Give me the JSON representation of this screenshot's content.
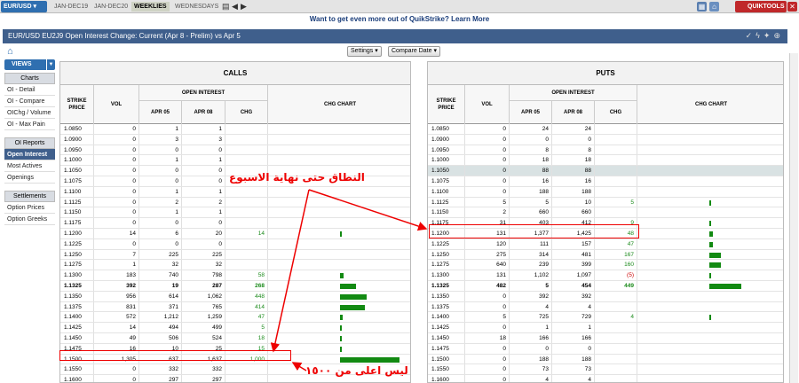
{
  "topbar": {
    "symbol": "EUR/USD",
    "tabs": [
      {
        "label": "JAN-DEC19",
        "active": false
      },
      {
        "label": "JAN-DEC20",
        "active": false
      },
      {
        "label": "WEEKLIES",
        "active": true
      },
      {
        "label": "WEDNESDAYS",
        "active": false
      }
    ],
    "tools_label": "QUIKTOOLS"
  },
  "promo": "Want to get even more out of QuikStrike? Learn More",
  "title": "EUR/USD EU2J9 Open Interest Change: Current (Apr 8 - Prelim) vs Apr 5",
  "controls": {
    "settings": "Settings",
    "compare": "Compare Date"
  },
  "sidebar": {
    "views": "VIEWS",
    "groups": [
      {
        "head": "Charts",
        "items": [
          "OI - Detail",
          "OI - Compare",
          "OIChg / Volume",
          "OI - Max Pain"
        ]
      },
      {
        "head": "OI Reports",
        "items": [
          "Open Interest",
          "Most Actives",
          "Openings"
        ]
      },
      {
        "head": "Settlements",
        "items": [
          "Option Prices",
          "Option Greeks"
        ]
      }
    ],
    "active": "Open Interest"
  },
  "headers": {
    "strike": "STRIKE PRICE",
    "vol": "VOL",
    "oi": "OPEN INTEREST",
    "apr05": "APR 05",
    "apr08": "APR 08",
    "chg": "CHG",
    "chart": "CHG CHART"
  },
  "calls": {
    "title": "CALLS",
    "rows": [
      {
        "strike": "1.0850",
        "vol": "0",
        "a5": "1",
        "a8": "1",
        "chg": ""
      },
      {
        "strike": "1.0900",
        "vol": "0",
        "a5": "3",
        "a8": "3",
        "chg": ""
      },
      {
        "strike": "1.0950",
        "vol": "0",
        "a5": "0",
        "a8": "0",
        "chg": ""
      },
      {
        "strike": "1.1000",
        "vol": "0",
        "a5": "1",
        "a8": "1",
        "chg": ""
      },
      {
        "strike": "1.1050",
        "vol": "0",
        "a5": "0",
        "a8": "0",
        "chg": ""
      },
      {
        "strike": "1.1075",
        "vol": "0",
        "a5": "0",
        "a8": "0",
        "chg": ""
      },
      {
        "strike": "1.1100",
        "vol": "0",
        "a5": "1",
        "a8": "1",
        "chg": ""
      },
      {
        "strike": "1.1125",
        "vol": "0",
        "a5": "2",
        "a8": "2",
        "chg": ""
      },
      {
        "strike": "1.1150",
        "vol": "0",
        "a5": "1",
        "a8": "1",
        "chg": ""
      },
      {
        "strike": "1.1175",
        "vol": "0",
        "a5": "0",
        "a8": "0",
        "chg": ""
      },
      {
        "strike": "1.1200",
        "vol": "14",
        "a5": "6",
        "a8": "20",
        "chg": "14"
      },
      {
        "strike": "1.1225",
        "vol": "0",
        "a5": "0",
        "a8": "0",
        "chg": ""
      },
      {
        "strike": "1.1250",
        "vol": "7",
        "a5": "225",
        "a8": "225",
        "chg": ""
      },
      {
        "strike": "1.1275",
        "vol": "1",
        "a5": "32",
        "a8": "32",
        "chg": ""
      },
      {
        "strike": "1.1300",
        "vol": "183",
        "a5": "740",
        "a8": "798",
        "chg": "58"
      },
      {
        "strike": "1.1325",
        "vol": "392",
        "a5": "19",
        "a8": "287",
        "chg": "268"
      },
      {
        "strike": "1.1350",
        "vol": "956",
        "a5": "614",
        "a8": "1,062",
        "chg": "448"
      },
      {
        "strike": "1.1375",
        "vol": "831",
        "a5": "371",
        "a8": "765",
        "chg": "414"
      },
      {
        "strike": "1.1400",
        "vol": "572",
        "a5": "1,212",
        "a8": "1,259",
        "chg": "47"
      },
      {
        "strike": "1.1425",
        "vol": "14",
        "a5": "494",
        "a8": "499",
        "chg": "5"
      },
      {
        "strike": "1.1450",
        "vol": "49",
        "a5": "506",
        "a8": "524",
        "chg": "18"
      },
      {
        "strike": "1.1475",
        "vol": "16",
        "a5": "10",
        "a8": "25",
        "chg": "15"
      },
      {
        "strike": "1.1500",
        "vol": "1,305",
        "a5": "637",
        "a8": "1,637",
        "chg": "1,000"
      },
      {
        "strike": "1.1550",
        "vol": "0",
        "a5": "332",
        "a8": "332",
        "chg": ""
      },
      {
        "strike": "1.1600",
        "vol": "0",
        "a5": "297",
        "a8": "297",
        "chg": ""
      }
    ]
  },
  "puts": {
    "title": "PUTS",
    "rows": [
      {
        "strike": "1.0850",
        "vol": "0",
        "a5": "24",
        "a8": "24",
        "chg": ""
      },
      {
        "strike": "1.0900",
        "vol": "0",
        "a5": "0",
        "a8": "0",
        "chg": ""
      },
      {
        "strike": "1.0950",
        "vol": "0",
        "a5": "8",
        "a8": "8",
        "chg": ""
      },
      {
        "strike": "1.1000",
        "vol": "0",
        "a5": "18",
        "a8": "18",
        "chg": ""
      },
      {
        "strike": "1.1050",
        "vol": "0",
        "a5": "88",
        "a8": "88",
        "chg": ""
      },
      {
        "strike": "1.1075",
        "vol": "0",
        "a5": "16",
        "a8": "16",
        "chg": ""
      },
      {
        "strike": "1.1100",
        "vol": "0",
        "a5": "188",
        "a8": "188",
        "chg": ""
      },
      {
        "strike": "1.1125",
        "vol": "5",
        "a5": "5",
        "a8": "10",
        "chg": "5"
      },
      {
        "strike": "1.1150",
        "vol": "2",
        "a5": "660",
        "a8": "660",
        "chg": ""
      },
      {
        "strike": "1.1175",
        "vol": "31",
        "a5": "403",
        "a8": "412",
        "chg": "9"
      },
      {
        "strike": "1.1200",
        "vol": "131",
        "a5": "1,377",
        "a8": "1,425",
        "chg": "48"
      },
      {
        "strike": "1.1225",
        "vol": "120",
        "a5": "111",
        "a8": "157",
        "chg": "47"
      },
      {
        "strike": "1.1250",
        "vol": "275",
        "a5": "314",
        "a8": "481",
        "chg": "167"
      },
      {
        "strike": "1.1275",
        "vol": "640",
        "a5": "239",
        "a8": "399",
        "chg": "160"
      },
      {
        "strike": "1.1300",
        "vol": "131",
        "a5": "1,102",
        "a8": "1,097",
        "chg": "(5)"
      },
      {
        "strike": "1.1325",
        "vol": "482",
        "a5": "5",
        "a8": "454",
        "chg": "449"
      },
      {
        "strike": "1.1350",
        "vol": "0",
        "a5": "392",
        "a8": "392",
        "chg": ""
      },
      {
        "strike": "1.1375",
        "vol": "0",
        "a5": "4",
        "a8": "4",
        "chg": ""
      },
      {
        "strike": "1.1400",
        "vol": "5",
        "a5": "725",
        "a8": "729",
        "chg": "4"
      },
      {
        "strike": "1.1425",
        "vol": "0",
        "a5": "1",
        "a8": "1",
        "chg": ""
      },
      {
        "strike": "1.1450",
        "vol": "18",
        "a5": "166",
        "a8": "166",
        "chg": ""
      },
      {
        "strike": "1.1475",
        "vol": "0",
        "a5": "0",
        "a8": "0",
        "chg": ""
      },
      {
        "strike": "1.1500",
        "vol": "0",
        "a5": "188",
        "a8": "188",
        "chg": ""
      },
      {
        "strike": "1.1550",
        "vol": "0",
        "a5": "73",
        "a8": "73",
        "chg": ""
      },
      {
        "strike": "1.1600",
        "vol": "0",
        "a5": "4",
        "a8": "4",
        "chg": ""
      }
    ]
  },
  "annotations": {
    "range_text": "النطاق حتى نهاية الاسبوع",
    "max_text": "ليس اعلى من ١٥٠٠"
  },
  "colors": {
    "bar": "#128a12",
    "annotation": "#e00000",
    "title_bar": "#3f5f8c"
  }
}
